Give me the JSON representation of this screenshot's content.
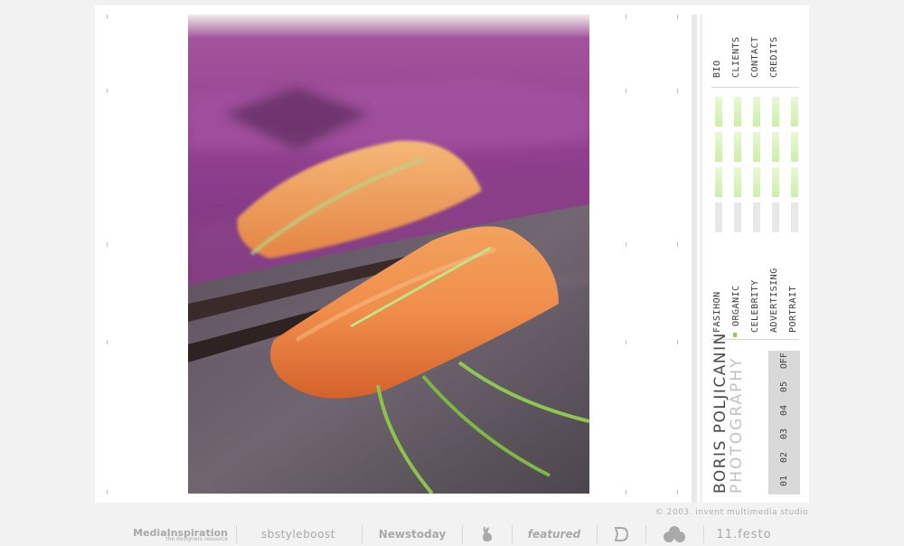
{
  "nav_top": {
    "items": [
      "BIO",
      "CLIENTS",
      "CONTACT",
      "CREDITS"
    ]
  },
  "categories": {
    "items": [
      "FASIHON",
      "ORGANIC",
      "CELEBRITY",
      "ADVERTISING",
      "PORTRAIT"
    ],
    "active": "ORGANIC"
  },
  "brand": {
    "name": "BORIS POLJICANIN",
    "tagline": "PHOTOGRAPHY"
  },
  "pages": {
    "items": [
      "01",
      "02",
      "03",
      "04",
      "05",
      "OFF"
    ]
  },
  "footer": {
    "copyright": "© 2003. invent multimedia studio",
    "badges": [
      "MediaInspiration",
      "the designers resource",
      "sbstyleboost",
      "Newstoday",
      "featured",
      "11.festo"
    ]
  },
  "colors": {
    "accent_green": "#8dcf57",
    "bar_green": "#d6f2b6",
    "panel_grey": "#d9d9d9",
    "background": "#f2f2f2"
  },
  "icons": [
    "rabbit-icon",
    "d-logo-icon",
    "clover-icon"
  ]
}
